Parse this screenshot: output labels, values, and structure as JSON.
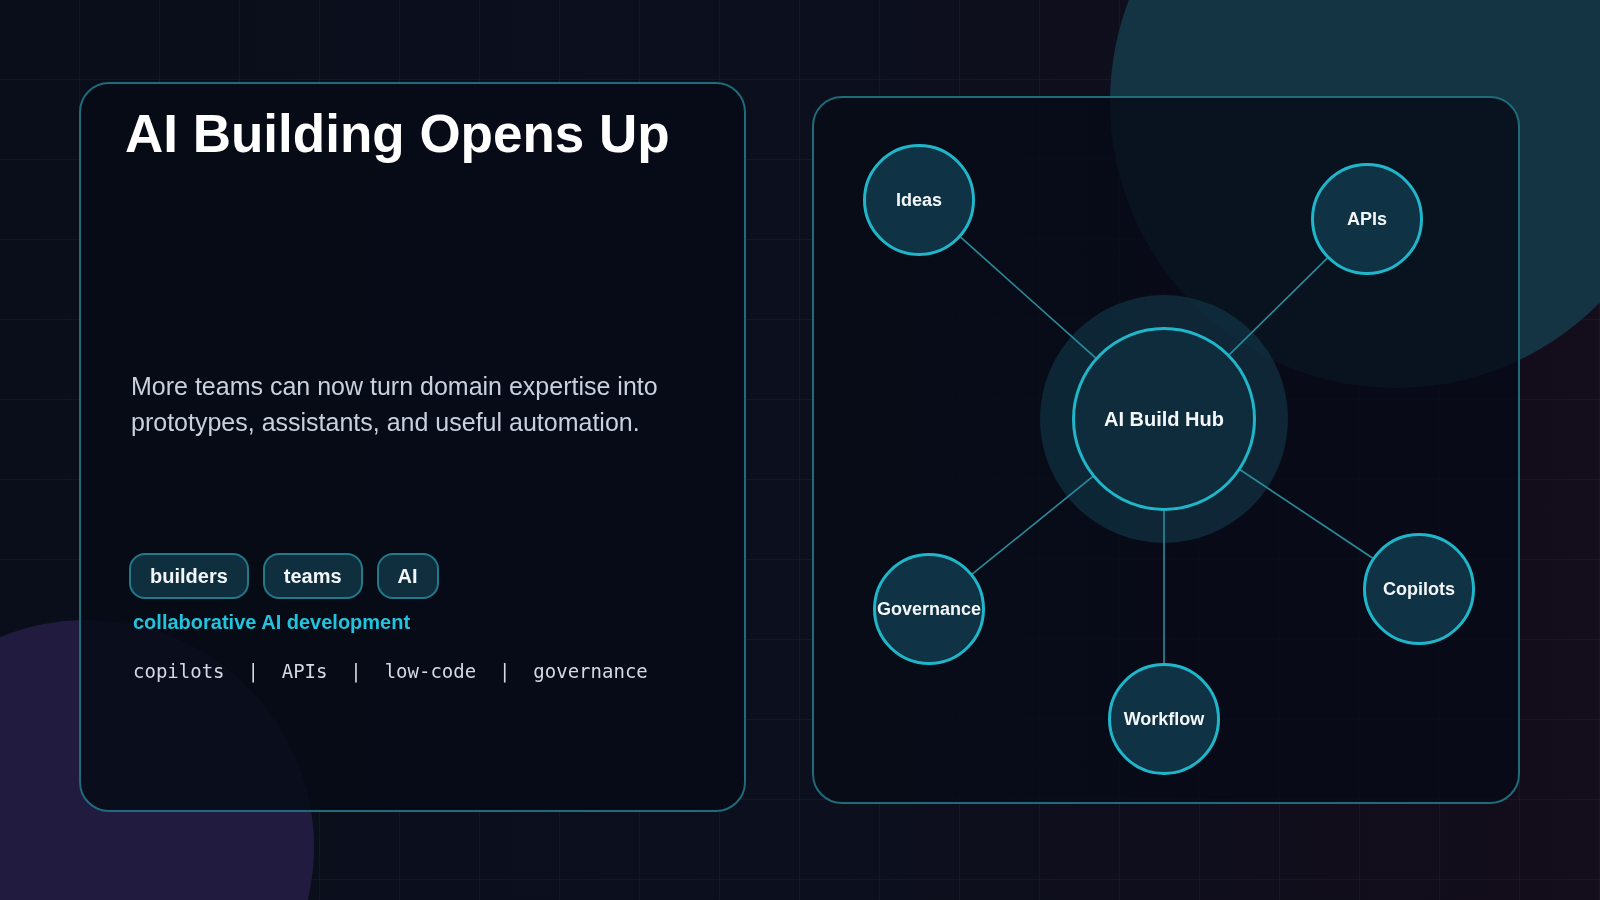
{
  "title": "AI Building Opens Up",
  "description": "More teams can now turn domain expertise into prototypes, assistants, and useful automation.",
  "tags": [
    {
      "label": "builders"
    },
    {
      "label": "teams"
    },
    {
      "label": "AI"
    }
  ],
  "tagline": "collaborative AI development",
  "keywords_line": "copilots  |  APIs  |  low-code  |  governance",
  "diagram": {
    "hub": {
      "label": "AI Build Hub"
    },
    "nodes": [
      {
        "label": "Ideas"
      },
      {
        "label": "APIs"
      },
      {
        "label": "Governance"
      },
      {
        "label": "Copilots"
      },
      {
        "label": "Workflow"
      }
    ]
  }
}
